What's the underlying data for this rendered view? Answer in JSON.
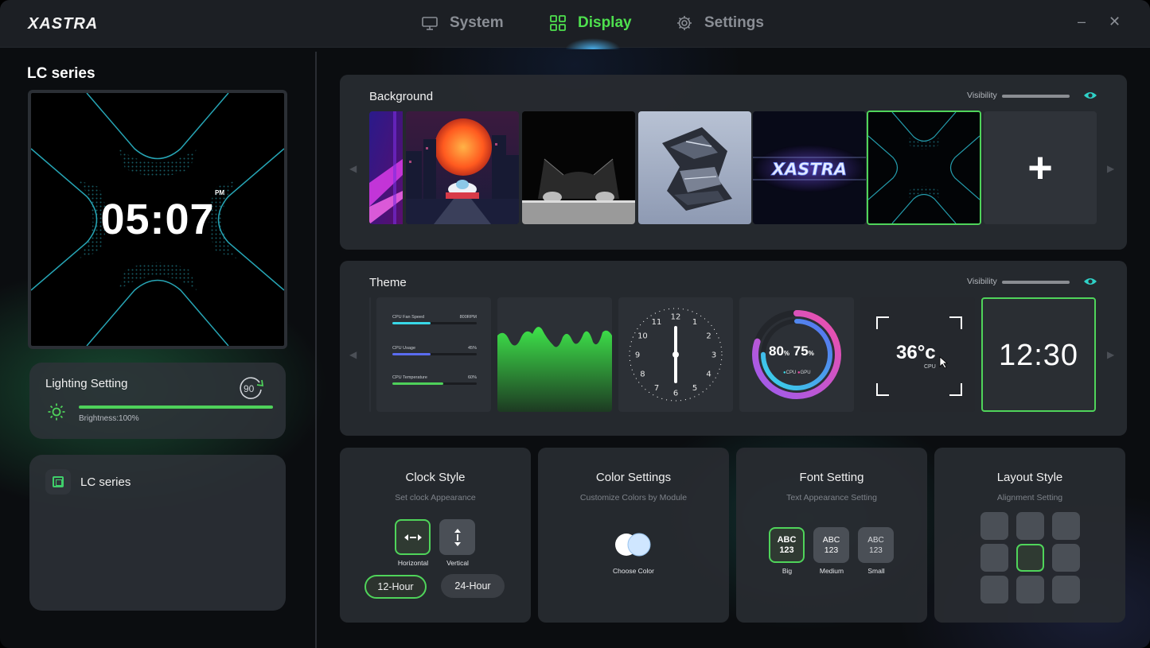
{
  "app": {
    "logo": "XASTRA"
  },
  "nav": {
    "tabs": [
      {
        "label": "System",
        "icon": "monitor-icon",
        "active": false
      },
      {
        "label": "Display",
        "icon": "grid-icon",
        "active": true
      },
      {
        "label": "Settings",
        "icon": "gear-icon",
        "active": false
      }
    ],
    "minimize": "–",
    "close": "✕"
  },
  "colors": {
    "accent": "#4ee04e",
    "panel": "#282b31",
    "background": "#0b0d10"
  },
  "sidebar": {
    "title": "LC series",
    "preview": {
      "time": "05:07",
      "ampm": "PM"
    },
    "lighting": {
      "title": "Lighting Setting",
      "rotation": "90",
      "brightness_label": "Brightness:100%",
      "brightness": 1.0
    },
    "devices": [
      {
        "name": "LC series"
      }
    ]
  },
  "background_panel": {
    "title": "Background",
    "visibility_label": "Visibility",
    "thumbnails": [
      {
        "name": "neon-stripes"
      },
      {
        "name": "cyber-city-sun"
      },
      {
        "name": "black-cat"
      },
      {
        "name": "chrome-sculpture"
      },
      {
        "name": "xastra-logo",
        "text": "XASTRA"
      },
      {
        "name": "x-pattern",
        "selected": true
      }
    ],
    "add_label": "+"
  },
  "theme_panel": {
    "title": "Theme",
    "visibility_label": "Visibility",
    "stats": [
      {
        "label": "CPU Fan Speed",
        "value": "800RPM",
        "fill": 0.45,
        "color": "#38d8e8"
      },
      {
        "label": "CPU Usage",
        "value": "45%",
        "fill": 0.45,
        "color": "#5a6cf0"
      },
      {
        "label": "CPU Temperature",
        "value": "60%",
        "fill": 0.6,
        "color": "#4ed15a"
      }
    ],
    "clock_numbers": [
      "12",
      "1",
      "2",
      "3",
      "4",
      "5",
      "6",
      "7",
      "8",
      "9",
      "10",
      "11"
    ],
    "ring": {
      "cpu": "80",
      "gpu": "75",
      "unit": "%",
      "cpu_label": "CPU",
      "gpu_label": "GPU",
      "cpu_fraction": 0.8,
      "gpu_fraction": 0.75
    },
    "temp": {
      "value": "36°c",
      "label": "CPU"
    },
    "digital_clock": "12:30"
  },
  "options": {
    "clock_style": {
      "title": "Clock Style",
      "subtitle": "Set clock Appearance",
      "horizontal": "Horizontal",
      "vertical": "Vertical",
      "hour12": "12-Hour",
      "hour24": "24-Hour"
    },
    "color_settings": {
      "title": "Color Settings",
      "subtitle": "Customize Colors by Module",
      "choose": "Choose Color"
    },
    "font_setting": {
      "title": "Font Setting",
      "subtitle": "Text Appearance Setting",
      "sample_top": "ABC",
      "sample_bottom": "123",
      "big": "Big",
      "medium": "Medium",
      "small": "Small"
    },
    "layout_style": {
      "title": "Layout Style",
      "subtitle": "Alignment Setting",
      "selected_cell": 4
    }
  }
}
